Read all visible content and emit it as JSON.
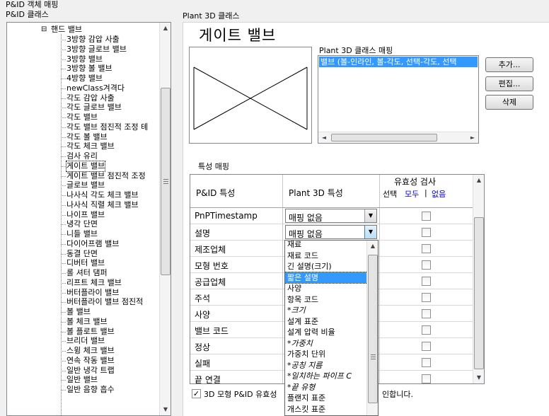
{
  "window": {
    "title": "P&ID 객체 매핑",
    "left_heading": "P&ID 클래스",
    "right_heading": "Plant 3D 클래스"
  },
  "tree": {
    "parent_label": "핸드 밸브",
    "parent_toggle": "⊟",
    "items": [
      "3방향 감압 사출",
      "3방향 글로브 밸브",
      "3방향 밸브",
      "3방향 볼 밸브",
      "4방향 밸브",
      "newClass겨격다",
      "각도 감압 사출",
      "각도 글로브 밸브",
      "각도 밸브",
      "각도 밸브 점진적 조정 톄",
      "각도 볼 밸브",
      "각도 체크 밸브",
      "검사 유리",
      "게이트 밸브",
      "게이트 밸브 점진적 조정",
      "글로브 밸브",
      "나사식 각도 체크 밸브",
      "나사식 직렬 체크 밸브",
      "나이프 밸브",
      "냉각 단면",
      "니들 밸브",
      "다이어프램 밸브",
      "동결 단면",
      "디버터 밸브",
      "롤 셔터 댐퍼",
      "리프트 체크 밸브",
      "버터플라이 밸브",
      "버터플라이 밸브 점진적",
      "볼 밸브",
      "볼 체크 밸브",
      "볼 플로트 밸브",
      "브리더 밸브",
      "스윙 체크 밸브",
      "연속 작동 밸브",
      "일반 냉각 트랩",
      "일반 밸브",
      "일반 음향 흡수"
    ],
    "selected_index": 13
  },
  "class_title": "게이트 밸브",
  "class_mapping": {
    "label": "Plant 3D 클래스 매핑",
    "items": [
      "밸브 (볼-인라인, 볼-각도, 선택-각도, 선택"
    ],
    "buttons": {
      "add": "추가...",
      "edit": "편집...",
      "delete": "삭제"
    }
  },
  "property_mapping": {
    "label": "특성 매핑",
    "headers": {
      "pid": "P&ID 특성",
      "plant": "Plant 3D 특성",
      "validity": "유효성 검사",
      "select": "선택",
      "all": "모두",
      "sep": "|",
      "none": "없음"
    },
    "rows": [
      {
        "pid": "PnPTimestamp",
        "plant": "매핑 없음",
        "combo": true
      },
      {
        "pid": "설명",
        "plant": "매핑 없음",
        "combo": true,
        "active": true
      },
      {
        "pid": "제조업체",
        "plant": ""
      },
      {
        "pid": "모형 번호",
        "plant": ""
      },
      {
        "pid": "공급업체",
        "plant": ""
      },
      {
        "pid": "주석",
        "plant": ""
      },
      {
        "pid": "사양",
        "plant": ""
      },
      {
        "pid": "밸브 코드",
        "plant": ""
      },
      {
        "pid": "정상",
        "plant": ""
      },
      {
        "pid": "실패",
        "plant": ""
      },
      {
        "pid": "끝 연결",
        "plant": ""
      }
    ]
  },
  "dropdown": {
    "items": [
      {
        "label": "재료",
        "italic": false
      },
      {
        "label": "재료 코드",
        "italic": false
      },
      {
        "label": "긴 설명(크기)",
        "italic": false
      },
      {
        "label": "짧은 설명",
        "italic": false
      },
      {
        "label": "사양",
        "italic": false
      },
      {
        "label": "항목 코드",
        "italic": false
      },
      {
        "label": "*크기",
        "italic": true
      },
      {
        "label": "설계 표준",
        "italic": false
      },
      {
        "label": "설계 압력 비율",
        "italic": false
      },
      {
        "label": "*가중치",
        "italic": true
      },
      {
        "label": "가중치 단위",
        "italic": false
      },
      {
        "label": "*공칭 지름",
        "italic": true
      },
      {
        "label": "*일치하는 파이프 C",
        "italic": true
      },
      {
        "label": "*끝 유형",
        "italic": true
      },
      {
        "label": "플랜지 표준",
        "italic": false
      },
      {
        "label": "개스킷 표준",
        "italic": false
      }
    ],
    "selected_index": 3
  },
  "footer": {
    "checkbox_checked": true,
    "checkbox_label_start": "3D 모형 P&ID 유효성",
    "checkbox_label_end": "인합니다."
  }
}
